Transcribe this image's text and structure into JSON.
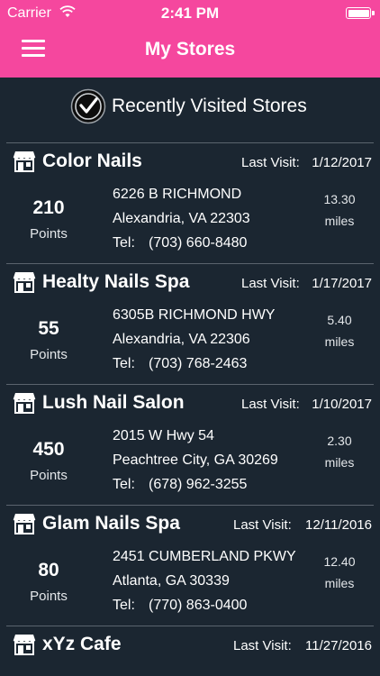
{
  "status_bar": {
    "carrier": "Carrier",
    "time": "2:41 PM"
  },
  "header": {
    "title": "My Stores"
  },
  "section": {
    "title": "Recently Visited Stores"
  },
  "visit_label": "Last Visit:",
  "points_label": "Points",
  "tel_label": "Tel:",
  "distance_unit": "miles",
  "stores": [
    {
      "name": "Color Nails",
      "last_visit": "1/12/2017",
      "points": "210",
      "address1": "6226 B RICHMOND",
      "address2": "Alexandria, VA 22303",
      "phone": "(703) 660-8480",
      "distance": "13.30"
    },
    {
      "name": "Healty Nails Spa",
      "last_visit": "1/17/2017",
      "points": "55",
      "address1": "6305B RICHMOND HWY",
      "address2": "Alexandria, VA 22306",
      "phone": "(703) 768-2463",
      "distance": "5.40"
    },
    {
      "name": "Lush Nail Salon",
      "last_visit": "1/10/2017",
      "points": "450",
      "address1": "2015 W Hwy 54",
      "address2": "Peachtree City, GA 30269",
      "phone": "(678) 962-3255",
      "distance": "2.30"
    },
    {
      "name": "Glam Nails Spa",
      "last_visit": "12/11/2016",
      "points": "80",
      "address1": "2451 CUMBERLAND PKWY",
      "address2": "Atlanta, GA 30339",
      "phone": "(770) 863-0400",
      "distance": "12.40"
    },
    {
      "name": "xYz Cafe",
      "last_visit": "11/27/2016"
    }
  ],
  "colors": {
    "accent": "#f5479e",
    "background": "#1b2631",
    "divider": "#5b646e"
  }
}
